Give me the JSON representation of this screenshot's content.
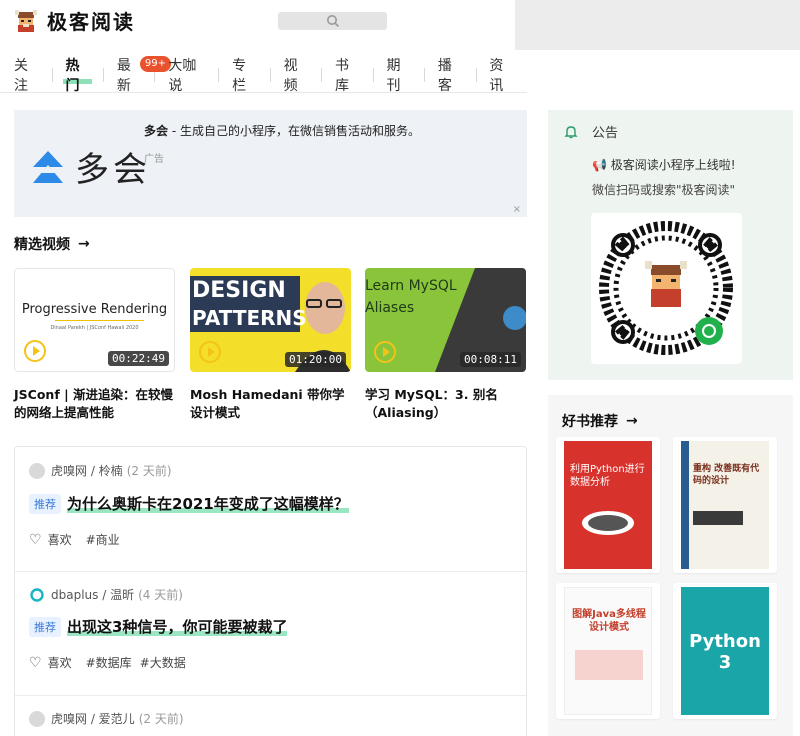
{
  "brand": {
    "name": "极客阅读"
  },
  "nav": {
    "items": [
      "关注",
      "热门",
      "最新",
      "大咖说",
      "专栏",
      "视频",
      "书库",
      "期刊",
      "播客",
      "资讯"
    ],
    "active": "热门",
    "badge": "99+"
  },
  "ad": {
    "logo_text": "多会",
    "title_bold": "多会",
    "title_rest": " - 生成自己的小程序，在微信销售活动和服务。",
    "tag": "广告",
    "close": "×"
  },
  "videos": {
    "section_title": "精选视频",
    "items": [
      {
        "thumb_text": "Progressive Rendering",
        "thumb_sub": "Dinaal Parekh | JSConf Hawaii 2020",
        "duration": "00:22:49",
        "title": "JSConf | 渐进追染：在较慢的网络上提高性能"
      },
      {
        "thumb_text1": "DESIGN",
        "thumb_text2": "PATTERNS",
        "duration": "01:20:00",
        "title": "Mosh Hamedani 带你学设计模式"
      },
      {
        "thumb_text1": "Learn MySQL",
        "thumb_text2": "Aliases",
        "duration": "00:08:11",
        "title": "学习 MySQL：3. 别名（Aliasing）"
      }
    ]
  },
  "articles": [
    {
      "source": "虎嗅网 / 柃楠",
      "time": "(2 天前)",
      "tag": "推荐",
      "title": "为什么奥斯卡在2021年变成了这幅模样？",
      "like": "喜欢",
      "tags": [
        "#商业"
      ]
    },
    {
      "source": "dbaplus / 温昕",
      "time": "(4 天前)",
      "tag": "推荐",
      "title": "出现这3种信号，你可能要被裁了",
      "like": "喜欢",
      "tags": [
        "#数据库",
        "#大数据"
      ]
    },
    {
      "source": "虎嗅网 / 爱范儿",
      "time": "(2 天前)"
    }
  ],
  "notice": {
    "title": "公告",
    "line1": "极客阅读小程序上线啦!",
    "line2": "微信扫码或搜索\"极客阅读\""
  },
  "books": {
    "section_title": "好书推荐",
    "items": [
      {
        "title": "利用Python进行数据分析"
      },
      {
        "title": "重构 改善既有代码的设计"
      },
      {
        "title": "图解Java多线程设计模式"
      },
      {
        "title": "Python 3"
      }
    ]
  },
  "colors": {
    "accent_green": "#8de0b8",
    "badge_red": "#e9522c",
    "tag_blue": "#3a7bd5"
  }
}
